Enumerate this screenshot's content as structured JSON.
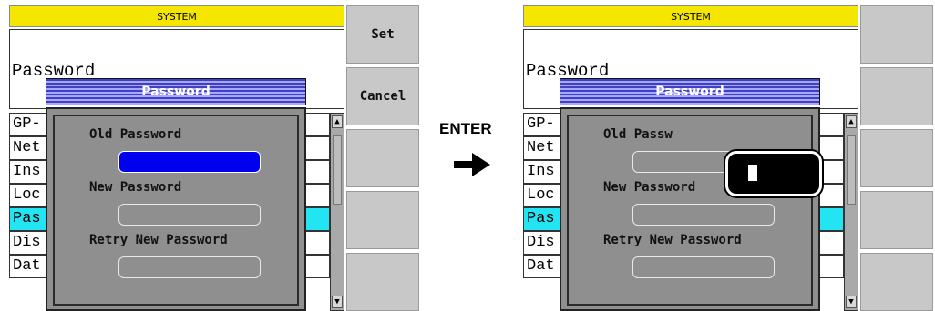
{
  "screens": [
    {
      "title": "SYSTEM",
      "header_label": "Password",
      "list_items": [
        "GP-",
        "Net",
        "Ins",
        "Loc",
        "Pas",
        "Dis",
        "Dat"
      ],
      "selected_index": 4,
      "softkeys": [
        "Set",
        "Cancel",
        "",
        "",
        ""
      ],
      "dialog": {
        "title": "Password",
        "old_label": "Old Password",
        "new_label": "New Password",
        "retry_label": "Retry New Password"
      }
    },
    {
      "title": "SYSTEM",
      "header_label": "Password",
      "list_items": [
        "GP-",
        "Net",
        "Ins",
        "Loc",
        "Pas",
        "Dis",
        "Dat"
      ],
      "selected_index": 4,
      "softkeys": [
        "",
        "",
        "",
        "",
        ""
      ],
      "dialog": {
        "title": "Password",
        "old_label": "Old Passw",
        "new_label": "New Password",
        "retry_label": "Retry New Password"
      }
    }
  ],
  "transition": {
    "label": "ENTER",
    "icon": "right-arrow-icon"
  },
  "colors": {
    "title_bar": "#f5e600",
    "selection": "#22e4f2",
    "active_field": "#0000f0",
    "dialog_title": "#4040c0",
    "dialog_body": "#8f8f8f",
    "softkey": "#c8c8c8"
  }
}
